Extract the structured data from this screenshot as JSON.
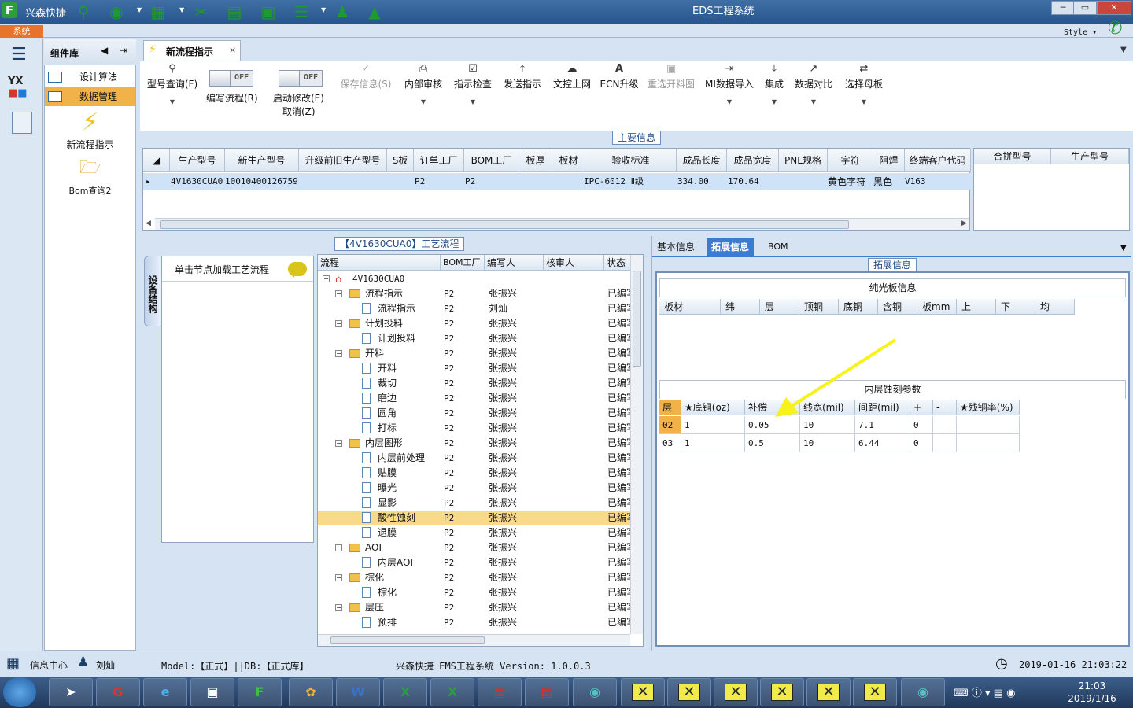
{
  "titlebar": {
    "logo": "F",
    "app_name": "兴森快捷",
    "window_title": "EDS工程系统",
    "minimize": "─",
    "maximize": "▭",
    "close": "✕"
  },
  "subbar": {
    "system_tab": "系统",
    "style_label": "Style ▾"
  },
  "component_panel": {
    "title": "组件库",
    "items": [
      {
        "label": "设计算法"
      },
      {
        "label": "数据管理"
      }
    ],
    "new_flow": "新流程指示",
    "bom_query": "Bom查询2"
  },
  "doc_tab": {
    "label": "新流程指示",
    "close": "×"
  },
  "ribbon": {
    "model_query": "型号查询(F)",
    "edit_flow": "编写流程(R)",
    "edit_flow_state": "OFF",
    "enable_edit": "启动修改(E)",
    "enable_edit_state": "OFF",
    "cancel": "取消(Z)",
    "save_info": "保存信息(S)",
    "internal_review": "内部审核",
    "instruction_check": "指示检查",
    "send_instruction": "发送指示",
    "doc_upload": "文控上网",
    "ecn_upgrade": "ECN升级",
    "reselect_cut": "重选开料图",
    "mi_import": "MI数据导入",
    "integrate": "集成",
    "data_compare": "数据对比",
    "select_mother": "选择母板"
  },
  "main_info": {
    "title": "主要信息",
    "columns": [
      "生产型号",
      "新生产型号",
      "升级前旧生产型号",
      "S板",
      "订单工厂",
      "BOM工厂",
      "板厚",
      "板材",
      "验收标准",
      "成品长度",
      "成品宽度",
      "PNL规格",
      "字符",
      "阻焊",
      "终端客户代码"
    ],
    "row": {
      "marker": "▸",
      "model": "4V1630CUA0",
      "new_model": "10010400126759",
      "order_factory": "P2",
      "bom_factory": "P2",
      "standard": "IPC-6012 Ⅱ级",
      "length": "334.00",
      "width": "170.64",
      "char": "黄色字符",
      "mask": "黑色",
      "customer": "V163"
    },
    "side_columns": [
      "合拼型号",
      "生产型号"
    ]
  },
  "flow_panel": {
    "title": "【4V1630CUA0】工艺流程",
    "vertical_tab": "设备结构",
    "node_hint": "单击节点加载工艺流程",
    "tree_columns": [
      "流程",
      "BOM工厂",
      "编写人",
      "核审人",
      "状态"
    ],
    "tree": [
      {
        "name": "4V1630CUA0",
        "level": 0,
        "kind": "root",
        "bom": "",
        "author": "",
        "status": ""
      },
      {
        "name": "流程指示",
        "level": 1,
        "kind": "folder",
        "bom": "P2",
        "author": "张振兴",
        "status": "已编写"
      },
      {
        "name": "流程指示",
        "level": 2,
        "kind": "doc",
        "bom": "P2",
        "author": "刘灿",
        "status": "已编写"
      },
      {
        "name": "计划投料",
        "level": 1,
        "kind": "folder",
        "bom": "P2",
        "author": "张振兴",
        "status": "已编写"
      },
      {
        "name": "计划投料",
        "level": 2,
        "kind": "doc",
        "bom": "P2",
        "author": "张振兴",
        "status": "已编写"
      },
      {
        "name": "开料",
        "level": 1,
        "kind": "folder",
        "bom": "P2",
        "author": "张振兴",
        "status": "已编写"
      },
      {
        "name": "开料",
        "level": 2,
        "kind": "doc",
        "bom": "P2",
        "author": "张振兴",
        "status": "已编写"
      },
      {
        "name": "裁切",
        "level": 2,
        "kind": "doc",
        "bom": "P2",
        "author": "张振兴",
        "status": "已编写"
      },
      {
        "name": "磨边",
        "level": 2,
        "kind": "doc",
        "bom": "P2",
        "author": "张振兴",
        "status": "已编写"
      },
      {
        "name": "圆角",
        "level": 2,
        "kind": "doc",
        "bom": "P2",
        "author": "张振兴",
        "status": "已编写"
      },
      {
        "name": "打标",
        "level": 2,
        "kind": "doc",
        "bom": "P2",
        "author": "张振兴",
        "status": "已编写"
      },
      {
        "name": "内层图形",
        "level": 1,
        "kind": "folder",
        "bom": "P2",
        "author": "张振兴",
        "status": "已编写"
      },
      {
        "name": "内层前处理",
        "level": 2,
        "kind": "doc",
        "bom": "P2",
        "author": "张振兴",
        "status": "已编写"
      },
      {
        "name": "贴膜",
        "level": 2,
        "kind": "doc",
        "bom": "P2",
        "author": "张振兴",
        "status": "已编写"
      },
      {
        "name": "曝光",
        "level": 2,
        "kind": "doc",
        "bom": "P2",
        "author": "张振兴",
        "status": "已编写"
      },
      {
        "name": "显影",
        "level": 2,
        "kind": "doc",
        "bom": "P2",
        "author": "张振兴",
        "status": "已编写"
      },
      {
        "name": "酸性蚀刻",
        "level": 2,
        "kind": "doc",
        "bom": "P2",
        "author": "张振兴",
        "status": "已编写",
        "selected": true
      },
      {
        "name": "退膜",
        "level": 2,
        "kind": "doc",
        "bom": "P2",
        "author": "张振兴",
        "status": "已编写"
      },
      {
        "name": "AOI",
        "level": 1,
        "kind": "folder",
        "bom": "P2",
        "author": "张振兴",
        "status": "已编写"
      },
      {
        "name": "内层AOI",
        "level": 2,
        "kind": "doc",
        "bom": "P2",
        "author": "张振兴",
        "status": "已编写"
      },
      {
        "name": "棕化",
        "level": 1,
        "kind": "folder",
        "bom": "P2",
        "author": "张振兴",
        "status": "已编写"
      },
      {
        "name": "棕化",
        "level": 2,
        "kind": "doc",
        "bom": "P2",
        "author": "张振兴",
        "status": "已编写"
      },
      {
        "name": "层压",
        "level": 1,
        "kind": "folder",
        "bom": "P2",
        "author": "张振兴",
        "status": "已编写"
      },
      {
        "name": "预排",
        "level": 2,
        "kind": "doc",
        "bom": "P2",
        "author": "张振兴",
        "status": "已编写"
      }
    ]
  },
  "right_panel": {
    "tabs": [
      "基本信息",
      "拓展信息",
      "BOM"
    ],
    "selected_tab": "拓展信息",
    "ext_title": "拓展信息",
    "plain_title": "纯光板信息",
    "plain_columns": [
      "板材",
      "纬",
      "层",
      "顶铜",
      "底铜",
      "含铜",
      "板mm",
      "上",
      "下",
      "均"
    ],
    "inner_title": "内层蚀刻参数",
    "inner_columns": [
      "层",
      "★底铜(oz)",
      "补偿",
      "线宽(mil)",
      "间距(mil)",
      "+",
      "-",
      "★残铜率(%)"
    ],
    "inner_rows": [
      [
        "02",
        "1",
        "0.05",
        "10",
        "7.1",
        "0",
        "",
        ""
      ],
      [
        "03",
        "1",
        "0.5",
        "10",
        "6.44",
        "0",
        "",
        ""
      ]
    ]
  },
  "statusbar": {
    "info_center": "信息中心",
    "user": "刘灿",
    "model_db": "Model:【正式】||DB:【正式库】",
    "version": "兴森快捷 EMS工程系统 Version: 1.0.0.3",
    "datetime": "2019-01-16 21:03:22"
  },
  "taskbar": {
    "time": "21:03",
    "date": "2019/1/16"
  }
}
